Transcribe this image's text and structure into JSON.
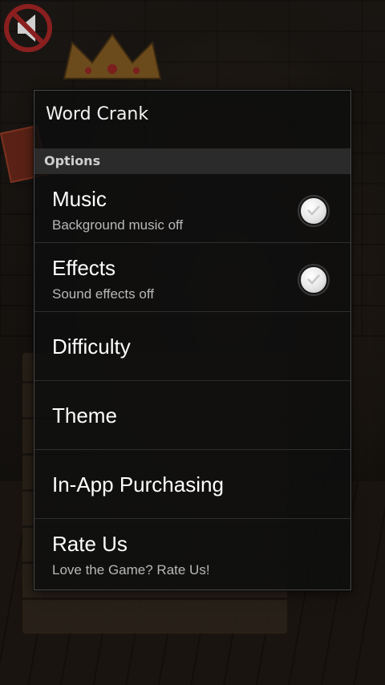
{
  "dialog": {
    "title": "Word Crank",
    "section_header": "Options",
    "items": [
      {
        "title": "Music",
        "summary": "Background music off",
        "checked": false
      },
      {
        "title": "Effects",
        "summary": "Sound effects off",
        "checked": false
      },
      {
        "title": "Difficulty"
      },
      {
        "title": "Theme"
      },
      {
        "title": "In-App Purchasing"
      },
      {
        "title": "Rate Us",
        "summary": "Love the Game? Rate Us!"
      }
    ]
  },
  "icons": {
    "sound_off": "no-sound-icon",
    "checkbox": "check-circle-icon"
  },
  "colors": {
    "dialog_bg": "#0e0e0e",
    "section_header_bg": "#2b2b2b",
    "text_primary": "#ffffff",
    "text_secondary": "#b8b8b8"
  }
}
